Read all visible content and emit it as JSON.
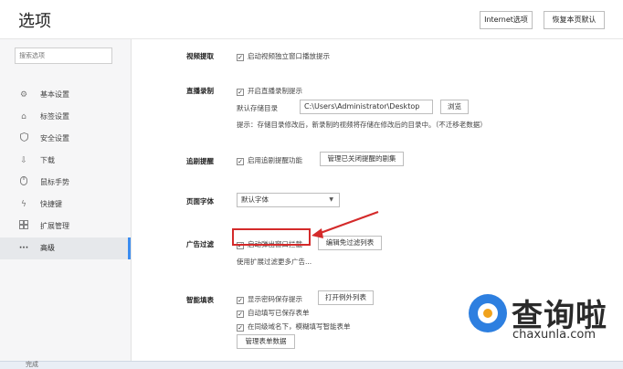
{
  "header": {
    "title": "选项",
    "internet_options": "Internet选项",
    "restore_defaults": "恢复本页默认"
  },
  "sidebar": {
    "search_placeholder": "搜索选项",
    "items": [
      {
        "label": "基本设置",
        "icon": "gear-icon"
      },
      {
        "label": "标签设置",
        "icon": "tab-icon"
      },
      {
        "label": "安全设置",
        "icon": "shield-icon"
      },
      {
        "label": "下载",
        "icon": "download-icon"
      },
      {
        "label": "鼠标手势",
        "icon": "mouse-icon"
      },
      {
        "label": "快捷键",
        "icon": "lightning-icon"
      },
      {
        "label": "扩展管理",
        "icon": "extensions-icon"
      },
      {
        "label": "高级",
        "icon": "more-icon",
        "active": true
      }
    ]
  },
  "main": {
    "video": {
      "label": "视频提取",
      "option": "启动视频独立窗口播放提示"
    },
    "live": {
      "label": "直播录制",
      "option": "开启直播录制提示",
      "dir_label": "默认存储目录",
      "dir_value": "C:\\Users\\Administrator\\Desktop",
      "browse": "浏览",
      "hint": "提示：存储目录修改后，新录制的视频将存储在修改后的目录中。（不迁移老数据）"
    },
    "drama": {
      "label": "追剧提醒",
      "option": "启用追剧提醒功能",
      "manage": "管理已关闭提醒的剧集"
    },
    "font": {
      "label": "页面字体",
      "value": "默认字体"
    },
    "adblock": {
      "label": "广告过滤",
      "option": "启动弹出窗口拦截",
      "edit_exceptions": "编辑免过滤列表",
      "ext_hint": "使用扩展过滤更多广告..."
    },
    "autofill": {
      "label": "智能填表",
      "opt1": "显示密码保存提示",
      "exceptions": "打开例外列表",
      "opt2": "自动填写已保存表单",
      "opt3": "在同级域名下，模糊填写智能表单",
      "manage_data": "管理表单数据"
    }
  },
  "status": {
    "text": "完成"
  },
  "watermark": {
    "brand": "查询啦",
    "url": "chaxunla.com"
  },
  "colors": {
    "accent": "#3b8cf0",
    "highlight": "#d42a2a",
    "watermark_blue": "#2d7fe0",
    "watermark_orange": "#f0a21c"
  }
}
